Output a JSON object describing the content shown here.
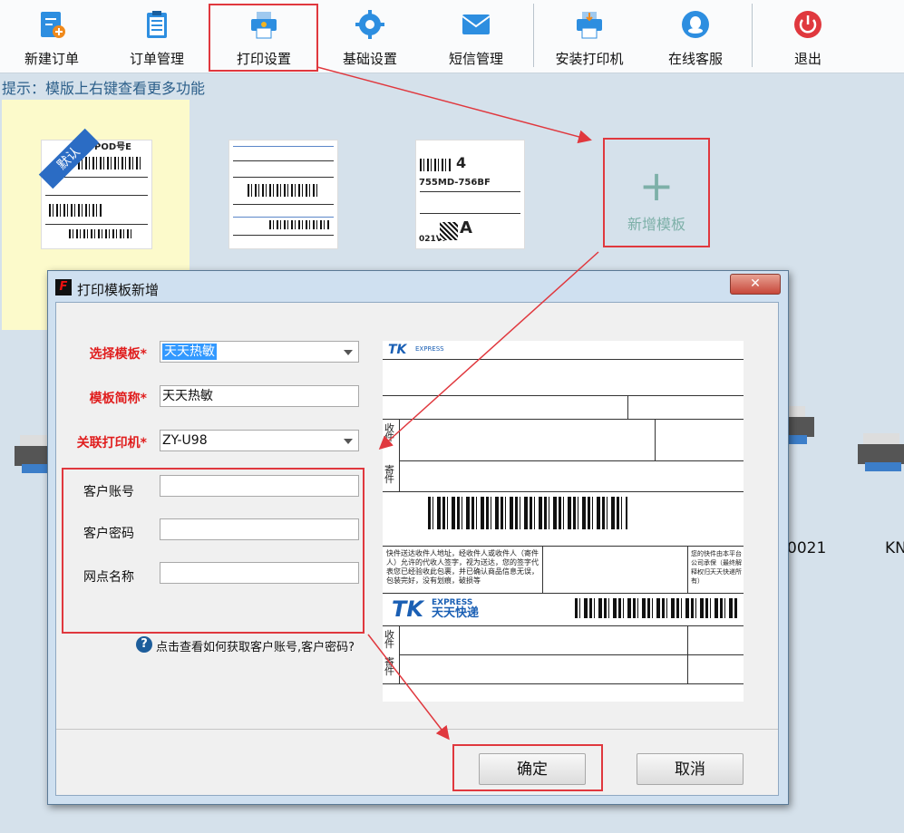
{
  "toolbar": {
    "items": [
      {
        "label": "新建订单",
        "icon": "new-order-icon"
      },
      {
        "label": "订单管理",
        "icon": "clipboard-icon"
      },
      {
        "label": "打印设置",
        "icon": "printer-settings-icon"
      },
      {
        "label": "基础设置",
        "icon": "gear-icon"
      },
      {
        "label": "短信管理",
        "icon": "mail-icon"
      },
      {
        "label": "安装打印机",
        "icon": "install-printer-icon"
      },
      {
        "label": "在线客服",
        "icon": "chat-support-icon"
      },
      {
        "label": "退出",
        "icon": "power-icon"
      }
    ]
  },
  "tip": "提示：模版上右键查看更多功能",
  "templates": {
    "default_badge": "默认",
    "add_label": "新增模板",
    "thumb1_text": "POD号E",
    "thumb3_code": "755MD-756BF",
    "thumb3_side": "021VF",
    "thumb3_num": "4",
    "thumb3_letter": "A"
  },
  "background": {
    "partial_text_1": "0021",
    "partial_text_2": "KN"
  },
  "dialog": {
    "title": "打印模板新增",
    "close_label": "✕",
    "fields": {
      "select_template": {
        "label": "选择模板*",
        "value": "天天热敏"
      },
      "template_name": {
        "label": "模板简称*",
        "value": "天天热敏"
      },
      "printer": {
        "label": "关联打印机*",
        "value": "ZY-U98"
      },
      "account": {
        "label": "客户账号",
        "value": ""
      },
      "password": {
        "label": "客户密码",
        "value": ""
      },
      "branch": {
        "label": "网点名称",
        "value": ""
      }
    },
    "help": "点击查看如何获取客户账号,客户密码?",
    "confirm": "确定",
    "cancel": "取消",
    "preview": {
      "express_small": "EXPRESS",
      "brand": "天天快递",
      "side_label_1": "收件",
      "side_label_2": "寄件",
      "sign_text": "快件送达收件人地址，经收件人或收件人（寄件人）允许的代收人签字，视为送达，您的签字代表您已经验收此包裹，并已确认商品信息无误，包装完好，没有划痕，破损等",
      "right_note": "您的快件由本平台公司承保（最终解释权归天天快递所有）"
    }
  },
  "colors": {
    "highlight": "#e0383e",
    "required_label": "#e01e1e",
    "selection": "#3399ff"
  }
}
